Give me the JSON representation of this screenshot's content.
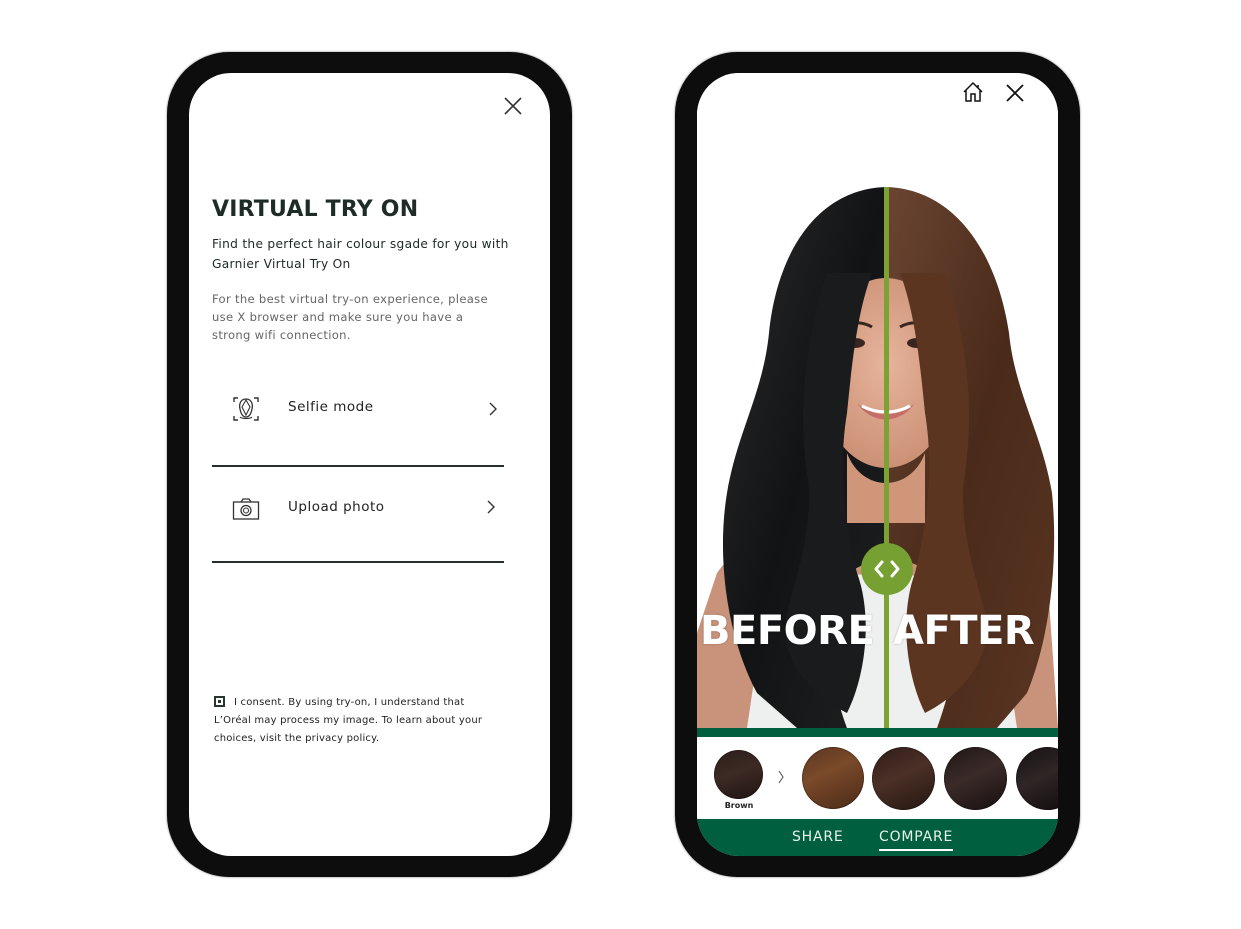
{
  "left_screen": {
    "close_icon": "close-icon",
    "title": "VIRTUAL TRY ON",
    "subtitle": "Find the perfect hair colour sgade for you with Garnier Virtual Try On",
    "hint": "For the best virtual try-on experience, please use X browser and make sure you have a strong wifi connection.",
    "options": [
      {
        "label": "Selfie mode",
        "icon": "face-scan-icon"
      },
      {
        "label": "Upload photo",
        "icon": "camera-icon"
      }
    ],
    "consent": {
      "checked": true,
      "text": "I consent. By using try-on, I understand that L’Oréal may process my image. To learn about your choices, visit the privacy policy."
    }
  },
  "right_screen": {
    "top_icons": [
      "home-icon",
      "close-icon"
    ],
    "compare_labels": {
      "before": "BEFORE",
      "after": "AFTER"
    },
    "slider_position_percent": 52,
    "current_shade": {
      "name": "Brown",
      "color": "#2f201b"
    },
    "shades": [
      {
        "color": "#6a4026"
      },
      {
        "color": "#3e271f"
      },
      {
        "color": "#2a1e1d"
      },
      {
        "color": "#201818"
      }
    ],
    "bottom_nav": {
      "share": "SHARE",
      "compare": "COMPARE",
      "active": "COMPARE"
    },
    "colors": {
      "brand_green": "#005f3e",
      "slider_green": "#76a032"
    }
  }
}
